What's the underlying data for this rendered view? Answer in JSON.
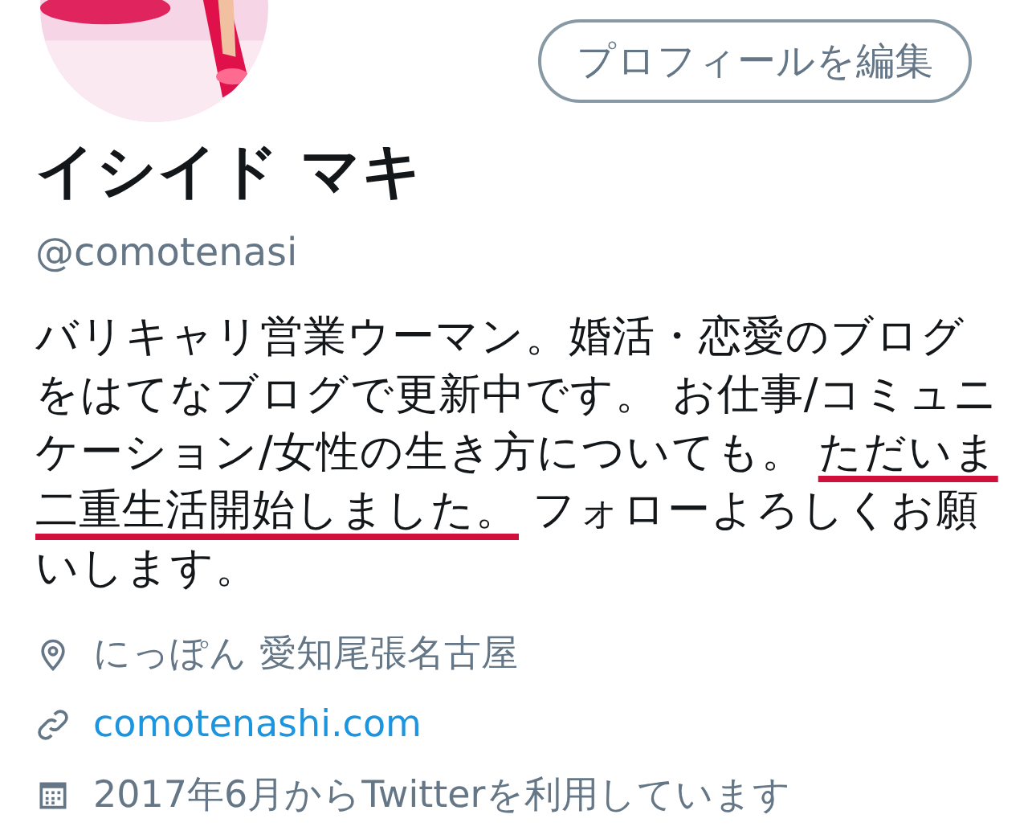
{
  "profile": {
    "edit_button": "プロフィールを編集",
    "name": "イシイド マキ",
    "handle": "@comotenasi",
    "bio": [
      {
        "text": "バリキャリ営業ウーマン。婚活・恋愛のブログをはてなブログで更新中です。 お仕事/コミュニケーション/女性の生き方についても。 ",
        "underlined": false
      },
      {
        "text": "ただいま二重生活開始しました。",
        "underlined": true
      },
      {
        "text": " フォローよろしくお願いします。",
        "underlined": false
      }
    ],
    "details": [
      {
        "kind": "location",
        "text": "にっぽん 愛知尾張名古屋"
      },
      {
        "kind": "link",
        "text": "comotenashi.com"
      },
      {
        "kind": "joined",
        "text": "2017年6月からTwitterを利用しています"
      }
    ]
  }
}
